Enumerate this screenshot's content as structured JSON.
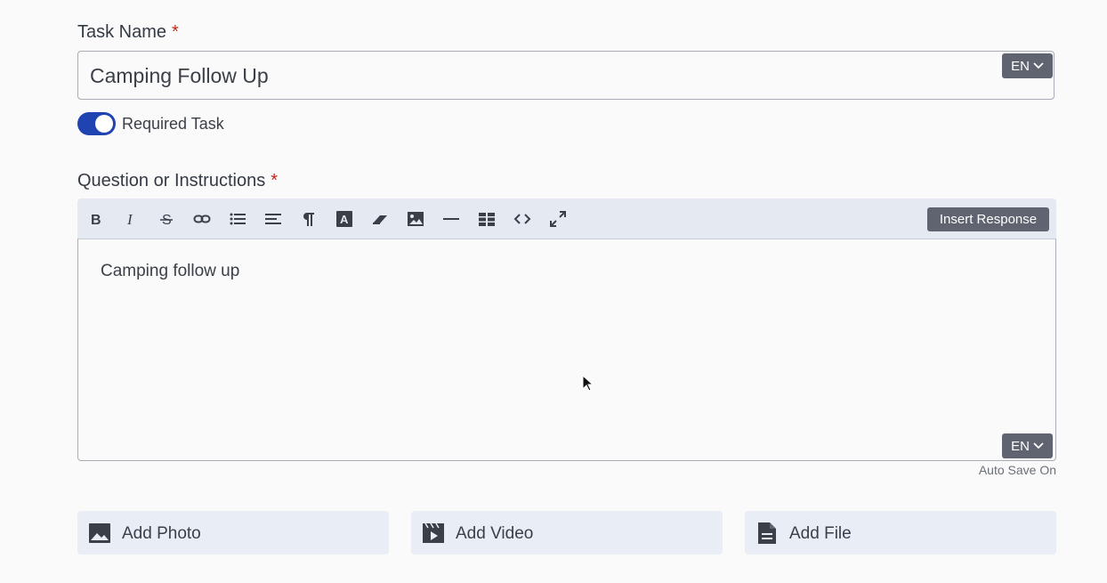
{
  "task_name": {
    "label": "Task Name",
    "required_mark": "*",
    "value": "Camping Follow Up",
    "language": "EN"
  },
  "required_task": {
    "label": "Required Task",
    "enabled": true
  },
  "instructions": {
    "label": "Question or Instructions",
    "required_mark": "*",
    "toolbar": {
      "icons": [
        "bold-icon",
        "italic-icon",
        "strikethrough-icon",
        "link-icon",
        "bulleted-list-icon",
        "align-icon",
        "paragraph-icon",
        "text-color-icon",
        "eraser-icon",
        "image-icon",
        "horizontal-rule-icon",
        "table-icon",
        "code-view-icon",
        "fullscreen-icon"
      ],
      "insert_response_label": "Insert Response"
    },
    "content": "Camping follow up",
    "language": "EN",
    "autosave_text": "Auto Save On"
  },
  "media": {
    "add_photo_label": "Add Photo",
    "add_video_label": "Add Video",
    "add_file_label": "Add File"
  },
  "colors": {
    "accent": "#1f43b0",
    "required": "#c0261f",
    "button_dark": "#5f6470",
    "toolbar_bg": "#e5e9f2",
    "media_bg": "#e9edf5"
  }
}
